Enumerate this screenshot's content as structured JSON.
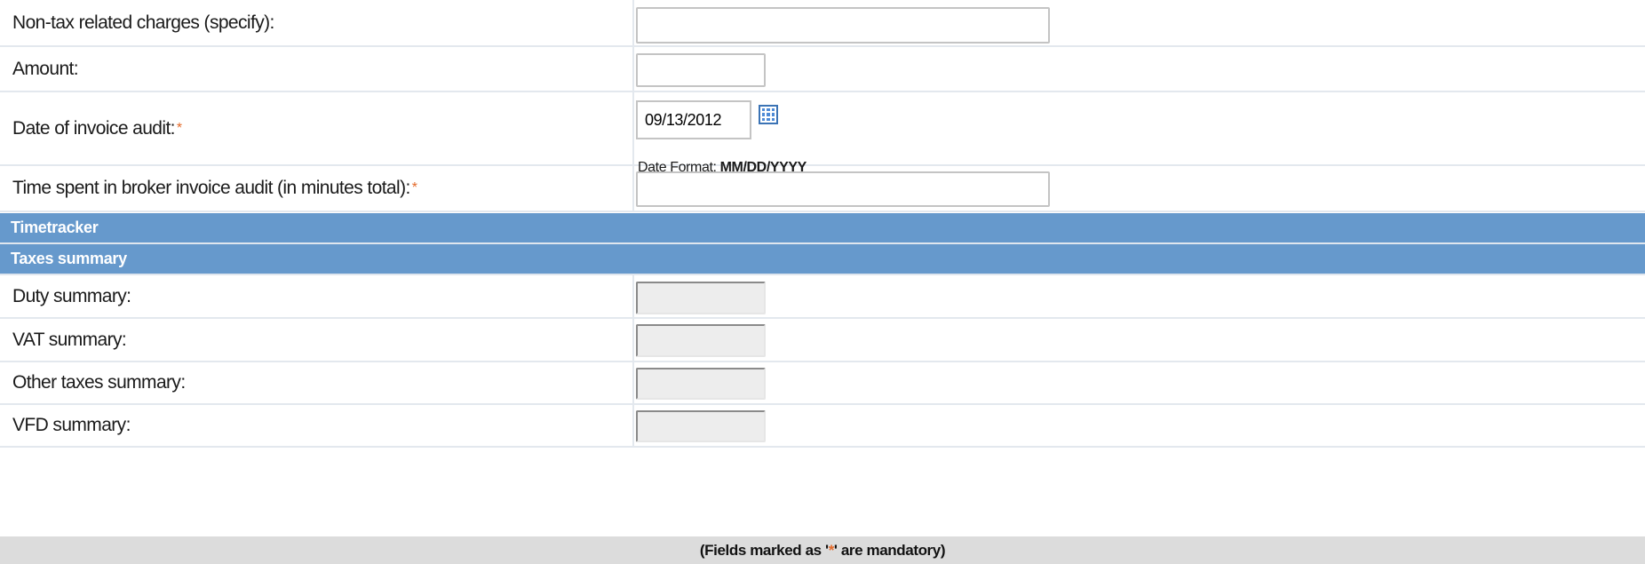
{
  "fields": {
    "non_tax_charges": {
      "label": "Non-tax related charges (specify):",
      "value": ""
    },
    "amount": {
      "label": "Amount:",
      "value": ""
    },
    "invoice_audit_date": {
      "label": "Date of invoice audit:",
      "required_mark": "*",
      "value": "09/13/2012",
      "format_prefix": "Date Format:",
      "format_value": "MM/DD/YYYY",
      "calendar_icon": "calendar-grid-icon"
    },
    "time_spent": {
      "label": "Time spent in broker invoice audit (in minutes total):",
      "required_mark": "*",
      "value": ""
    }
  },
  "sections": {
    "timetracker": "Timetracker",
    "taxes_summary": "Taxes summary"
  },
  "summaries": [
    {
      "label": "Duty summary:",
      "value": ""
    },
    {
      "label": "VAT summary:",
      "value": ""
    },
    {
      "label": "Other taxes summary:",
      "value": ""
    },
    {
      "label": "VFD summary:",
      "value": ""
    }
  ],
  "footer": {
    "before": "(Fields marked as '",
    "star": "*",
    "after": "' are mandatory)"
  },
  "colors": {
    "section_header": "#6699cc",
    "required_mark": "#e46a2a",
    "footer_bg": "#dcdcdc",
    "icon_blue": "#4d8ad6"
  }
}
